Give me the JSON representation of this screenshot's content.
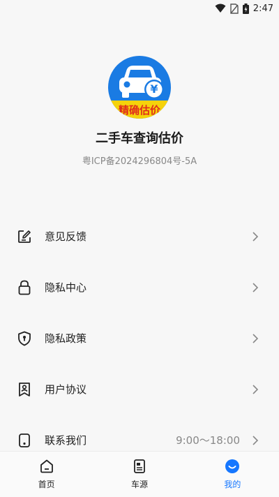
{
  "status_bar": {
    "time": "2:47"
  },
  "profile": {
    "logo_text": "精确估价",
    "logo_symbol": "¥",
    "app_name": "二手车查询估价",
    "icp": "粤ICP备2024296804号-5A"
  },
  "menu": {
    "items": [
      {
        "label": "意见反馈",
        "icon": "feedback-edit-icon"
      },
      {
        "label": "隐私中心",
        "icon": "lock-icon"
      },
      {
        "label": "隐私政策",
        "icon": "shield-keyhole-icon"
      },
      {
        "label": "用户协议",
        "icon": "user-agreement-icon"
      },
      {
        "label": "联系我们",
        "icon": "phone-icon",
        "extra": "9:00～18:00"
      }
    ]
  },
  "tab_bar": {
    "tabs": [
      {
        "label": "首页",
        "icon": "home-icon"
      },
      {
        "label": "车源",
        "icon": "car-source-icon"
      },
      {
        "label": "我的",
        "icon": "profile-icon",
        "active": true
      }
    ]
  },
  "colors": {
    "accent": "#1677ff",
    "logo_blue": "#1a7be3",
    "logo_band": "#f5d20b",
    "logo_text": "#e02b1c"
  }
}
